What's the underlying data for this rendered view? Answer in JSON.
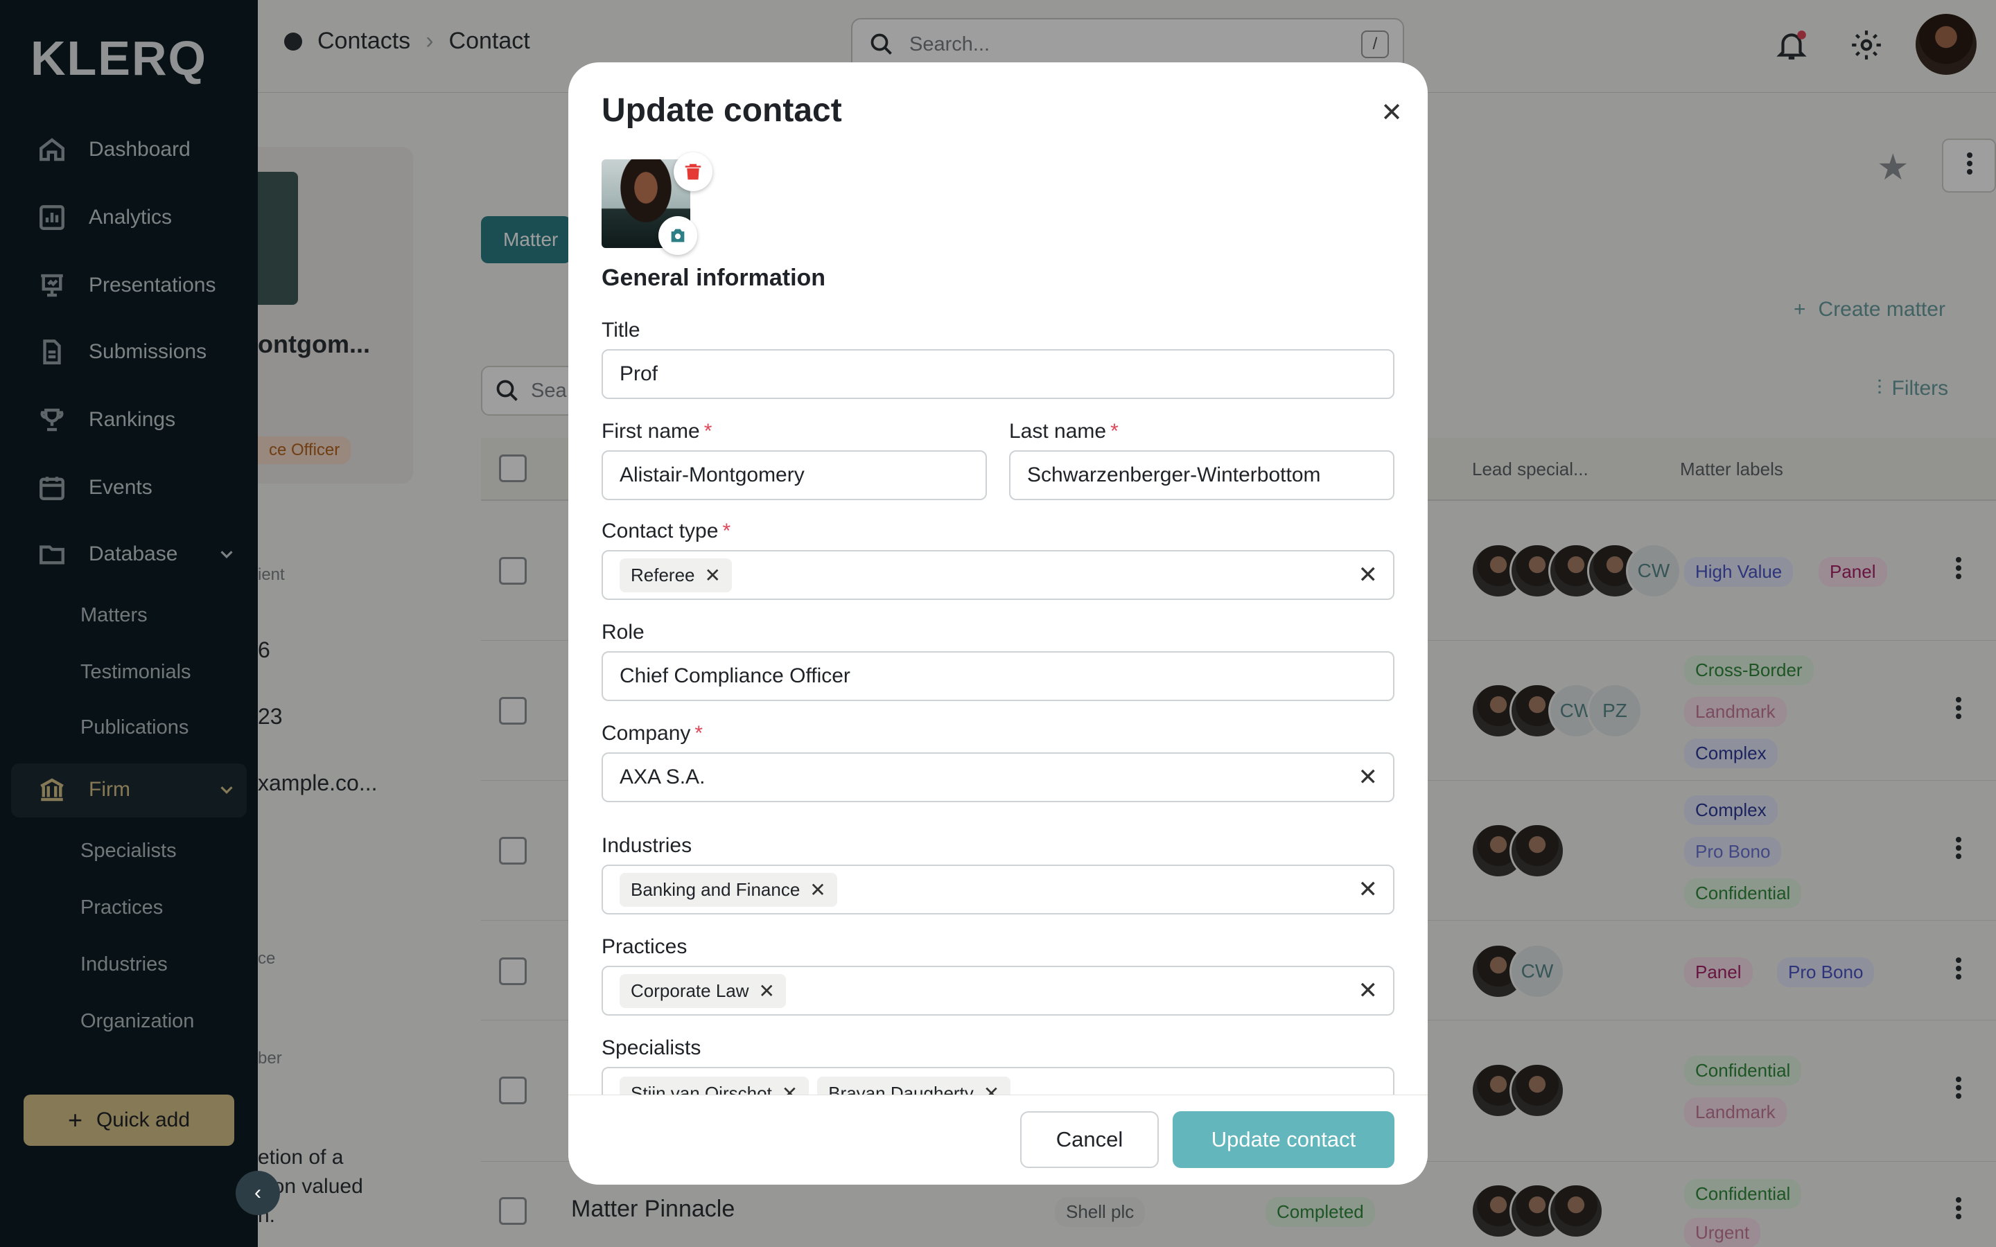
{
  "app": {
    "logo": "KLERQ"
  },
  "sidebar": {
    "items": [
      {
        "label": "Dashboard",
        "icon": "home-icon"
      },
      {
        "label": "Analytics",
        "icon": "bar-chart-icon"
      },
      {
        "label": "Presentations",
        "icon": "presentation-icon"
      },
      {
        "label": "Submissions",
        "icon": "document-icon"
      },
      {
        "label": "Rankings",
        "icon": "trophy-icon"
      },
      {
        "label": "Events",
        "icon": "calendar-icon"
      },
      {
        "label": "Database",
        "icon": "folder-icon"
      }
    ],
    "database_sub": [
      "Matters",
      "Testimonials",
      "Publications"
    ],
    "firm": {
      "label": "Firm",
      "icon": "bank-icon"
    },
    "firm_sub": [
      "Specialists",
      "Practices",
      "Industries",
      "Organization"
    ],
    "quick_add": "Quick add"
  },
  "topbar": {
    "breadcrumb": [
      "Contacts",
      "Contact"
    ],
    "search_placeholder": "Search...",
    "search_shortcut": "/"
  },
  "background": {
    "name_partial": "ontgom...",
    "role_partial": "ce Officer",
    "tab_partial": "Matter",
    "search_partial": "Sea",
    "create_matter": "Create matter",
    "filters": "Filters",
    "col_lead": "Lead special...",
    "col_labels": "Matter labels",
    "side_fragments": [
      "ient",
      "6",
      "23",
      "xample.co...",
      "ce",
      "ber",
      "etion of a",
      "sion valued",
      "n."
    ],
    "last_row": {
      "title": "Matter Pinnacle",
      "client": "Shell plc",
      "status": "Completed"
    },
    "rows": [
      {
        "initials": [
          "CW"
        ],
        "labels": [
          "High Value",
          "Panel"
        ]
      },
      {
        "initials": [
          "CW",
          "PZ"
        ],
        "labels": [
          "Cross-Border",
          "Landmark",
          "Complex"
        ]
      },
      {
        "initials": [],
        "labels": [
          "Complex",
          "Pro Bono",
          "Confidential"
        ]
      },
      {
        "initials": [
          "CW"
        ],
        "labels": [
          "Panel",
          "Pro Bono"
        ]
      },
      {
        "initials": [],
        "labels": [
          "Confidential",
          "Landmark"
        ]
      },
      {
        "initials": [],
        "labels": [
          "Confidential",
          "Urgent"
        ]
      }
    ]
  },
  "modal": {
    "title": "Update contact",
    "section": "General information",
    "title_label": "Title",
    "title_value": "Prof",
    "first_name_label": "First name",
    "first_name_value": "Alistair-Montgomery",
    "last_name_label": "Last name",
    "last_name_value": "Schwarzenberger-Winterbottom",
    "contact_type_label": "Contact type",
    "contact_type_chips": [
      "Referee"
    ],
    "role_label": "Role",
    "role_value": "Chief Compliance Officer",
    "company_label": "Company",
    "company_value": "AXA S.A.",
    "industries_label": "Industries",
    "industries_chips": [
      "Banking and Finance"
    ],
    "practices_label": "Practices",
    "practices_chips": [
      "Corporate Law"
    ],
    "specialists_label": "Specialists",
    "specialists_chips": [
      "Stijn van Oirschot",
      "Brayan Daugherty"
    ],
    "required_mark": "*",
    "cancel": "Cancel",
    "submit": "Update contact"
  },
  "colors": {
    "sidebar_bg": "#0e1d25",
    "accent_teal": "#63b6bc",
    "quick_add": "#d8c38a",
    "required": "#e0475a",
    "delete_red": "#e53935"
  }
}
